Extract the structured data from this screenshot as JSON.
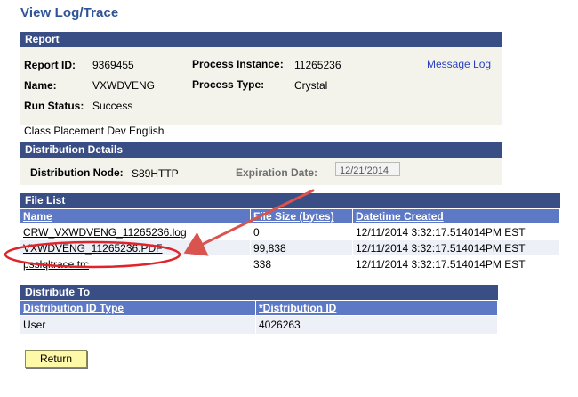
{
  "page": {
    "title": "View Log/Trace"
  },
  "report": {
    "section_title": "Report",
    "report_id_label": "Report ID:",
    "report_id": "9369455",
    "process_instance_label": "Process Instance:",
    "process_instance": "11265236",
    "message_log_link": "Message Log",
    "name_label": "Name:",
    "name": "VXWDVENG",
    "process_type_label": "Process Type:",
    "process_type": "Crystal",
    "run_status_label": "Run Status:",
    "run_status": "Success",
    "description": "Class Placement Dev English"
  },
  "distribution": {
    "section_title": "Distribution Details",
    "node_label": "Distribution Node:",
    "node": "S89HTTP",
    "expiration_label": "Expiration Date:",
    "expiration": "12/21/2014"
  },
  "file_list": {
    "section_title": "File List",
    "columns": [
      "Name",
      "File Size (bytes)",
      "Datetime Created"
    ],
    "rows": [
      {
        "name": "CRW_VXWDVENG_11265236.log",
        "size": "0",
        "created": "12/11/2014  3:32:17.514014PM EST"
      },
      {
        "name": "VXWDVENG_11265236.PDF",
        "size": "99,838",
        "created": "12/11/2014  3:32:17.514014PM EST"
      },
      {
        "name": "psslqltrace.trc",
        "size": "338",
        "created": "12/11/2014  3:32:17.514014PM EST"
      }
    ]
  },
  "distribute_to": {
    "section_title": "Distribute To",
    "columns": [
      "Distribution ID Type",
      "*Distribution ID"
    ],
    "rows": [
      {
        "type": "User",
        "id": "4026263"
      }
    ]
  },
  "actions": {
    "return_label": "Return"
  },
  "annotation": {
    "arrow_color": "#d9534f",
    "circle_color": "#e0242a"
  }
}
